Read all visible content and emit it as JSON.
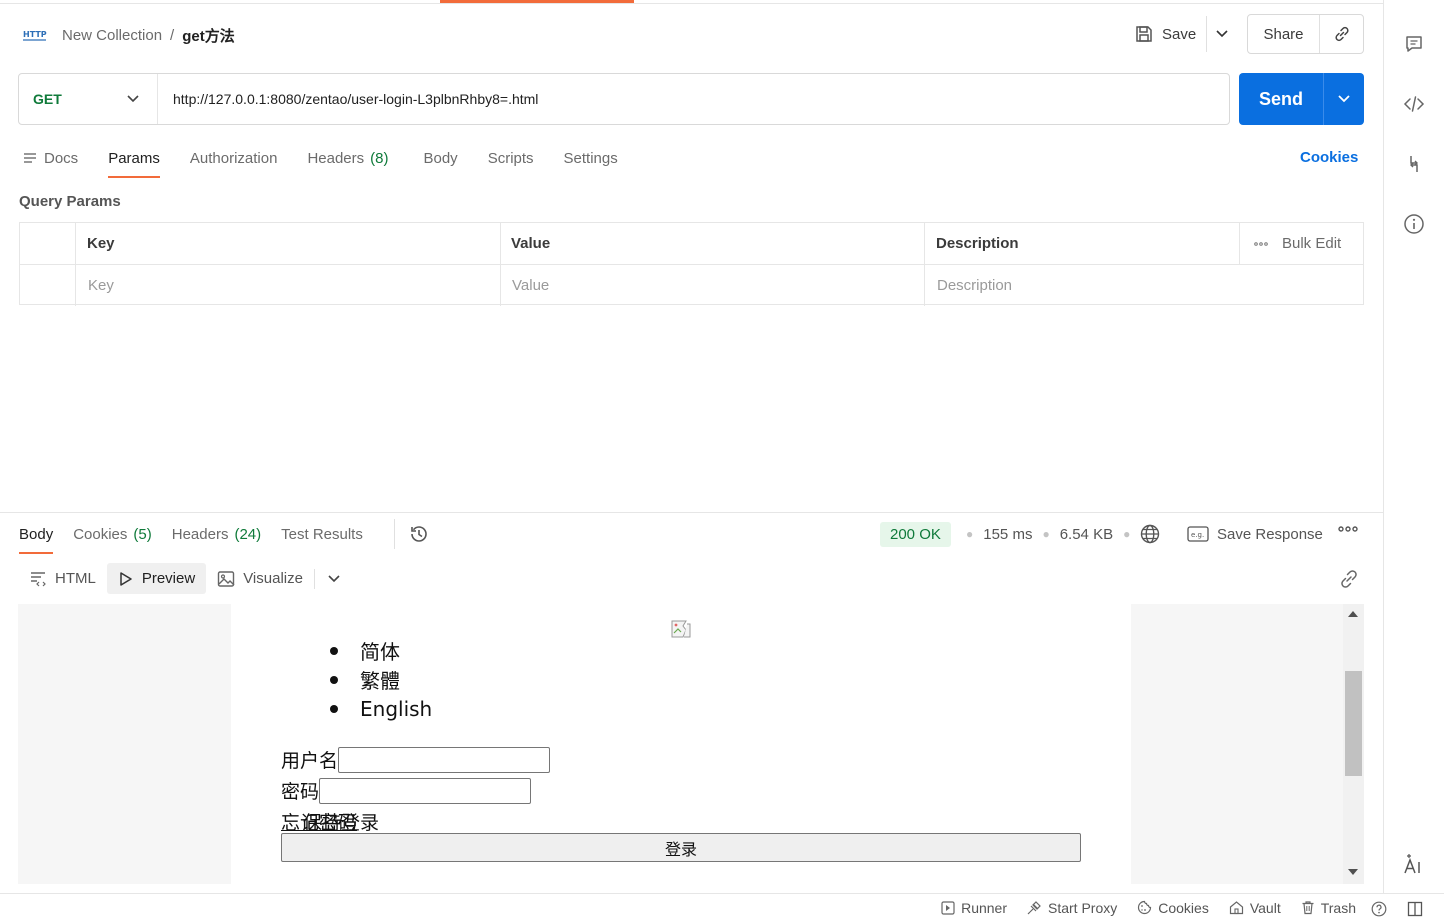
{
  "header": {
    "collection": "New Collection",
    "separator": "/",
    "request_name": "get方法",
    "save_label": "Save",
    "share_label": "Share"
  },
  "request": {
    "method": "GET",
    "url": "http://127.0.0.1:8080/zentao/user-login-L3plbnRhby8=.html",
    "send_label": "Send"
  },
  "tabs": {
    "docs": "Docs",
    "params": "Params",
    "authorization": "Authorization",
    "headers": "Headers",
    "headers_count": "(8)",
    "body": "Body",
    "scripts": "Scripts",
    "settings": "Settings",
    "cookies_link": "Cookies"
  },
  "query_params": {
    "title": "Query Params",
    "columns": {
      "key": "Key",
      "value": "Value",
      "description": "Description",
      "bulk_edit": "Bulk Edit"
    },
    "placeholders": {
      "key": "Key",
      "value": "Value",
      "description": "Description"
    }
  },
  "response": {
    "tabs": {
      "body": "Body",
      "cookies": "Cookies",
      "cookies_count": "(5)",
      "headers": "Headers",
      "headers_count": "(24)",
      "test_results": "Test Results"
    },
    "status": "200 OK",
    "time": "155 ms",
    "size": "6.54 KB",
    "save_response": "Save Response",
    "view_modes": {
      "html": "HTML",
      "preview": "Preview",
      "visualize": "Visualize"
    },
    "preview": {
      "languages": [
        "简体",
        "繁體",
        "English"
      ],
      "username_label": "用户名",
      "password_label": "密码",
      "forgot_password": "忘记密码",
      "remember_me": "保持登录",
      "login_button": "登录"
    }
  },
  "footer": {
    "runner": "Runner",
    "start_proxy": "Start Proxy",
    "cookies": "Cookies",
    "vault": "Vault",
    "trash": "Trash"
  },
  "colors": {
    "accent_orange": "#f26b3a",
    "send_blue": "#0a6fe0",
    "method_green": "#0f7a3a",
    "status_bg": "#e6f6ea"
  }
}
